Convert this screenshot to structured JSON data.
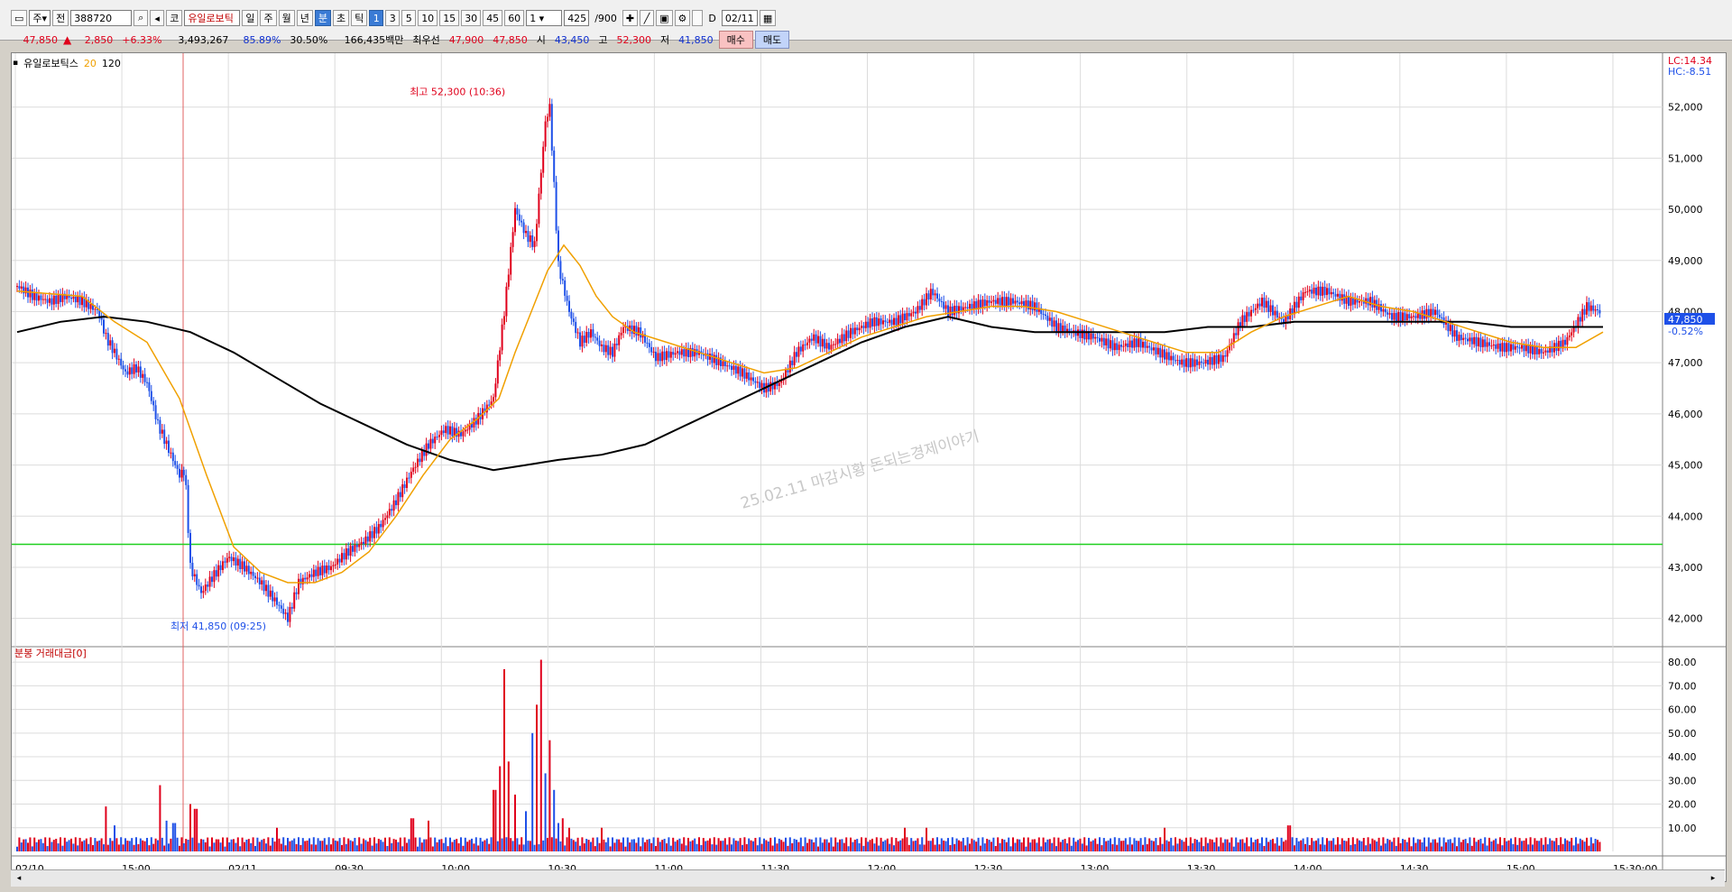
{
  "toolbar": {
    "market": "주",
    "scope": "전",
    "code": "388720",
    "name": "유일로보틱",
    "periods": [
      "일",
      "주",
      "월",
      "년",
      "분",
      "초",
      "틱"
    ],
    "period_selected": "분",
    "intervals": [
      "1",
      "3",
      "5",
      "10",
      "15",
      "30",
      "45",
      "60"
    ],
    "interval_selected": "1",
    "count_value": "1",
    "range_value": "425",
    "range_total": "/900",
    "date_checkbox_label": "D",
    "date_value": "02/11"
  },
  "quote": {
    "price": "47,850",
    "arrow": "▲",
    "change": "2,850",
    "change_pct": "+6.33%",
    "volume": "3,493,267",
    "ratio1": "85.89%",
    "ratio2": "30.50%",
    "amount": "166,435백만",
    "priority_label": "최우선",
    "ask": "47,900",
    "bid": "47,850",
    "open_label": "시",
    "open": "43,450",
    "high_label": "고",
    "high": "52,300",
    "low_label": "저",
    "low": "41,850",
    "buy_label": "매수",
    "sell_label": "매도"
  },
  "legend": {
    "name": "유일로보틱스",
    "ma20": "20",
    "ma120": "120"
  },
  "volume_label": "분봉 거래대금[0]",
  "colors": {
    "up": "#e0001b",
    "down": "#1e50e8",
    "ma20": "#f0a000",
    "ma120": "#000000",
    "support": "#20d020",
    "grid": "#dcdcdc"
  },
  "chart_data": [
    {
      "type": "candlestick",
      "ylim": [
        41500,
        52700
      ],
      "y_ticks": [
        "52,000",
        "51,000",
        "50,000",
        "49,000",
        "48,000",
        "47,000",
        "46,000",
        "45,000",
        "44,000",
        "43,000",
        "42,000"
      ],
      "x_ticks": [
        "02/10",
        "15:00",
        "02/11",
        "09:30",
        "10:00",
        "10:30",
        "11:00",
        "11:30",
        "12:00",
        "12:30",
        "13:00",
        "13:30",
        "14:00",
        "14:30",
        "15:00",
        "15:30:00"
      ],
      "current_price_label": "47,850",
      "current_change_label": "-0.52%",
      "lc_label": "LC:14.34",
      "hc_label": "HC:-8.51",
      "support_level": 43450,
      "high_annotation": "최고 52,300 (10:36)",
      "low_annotation": "최저 41,850 (09:25)",
      "watermark": "25.02.11 마감시황 돈되는경제이야기",
      "close_path": [
        [
          0,
          48500
        ],
        [
          15,
          48300
        ],
        [
          30,
          48200
        ],
        [
          45,
          48300
        ],
        [
          60,
          48200
        ],
        [
          75,
          48000
        ],
        [
          82,
          47500
        ],
        [
          90,
          47200
        ],
        [
          100,
          46800
        ],
        [
          110,
          46900
        ],
        [
          120,
          46600
        ],
        [
          130,
          45800
        ],
        [
          140,
          45300
        ],
        [
          150,
          44800
        ],
        [
          155,
          44900
        ],
        [
          160,
          43000
        ],
        [
          170,
          42500
        ],
        [
          180,
          42800
        ],
        [
          195,
          43200
        ],
        [
          210,
          43000
        ],
        [
          225,
          42700
        ],
        [
          240,
          42300
        ],
        [
          250,
          42000
        ],
        [
          260,
          42700
        ],
        [
          275,
          42900
        ],
        [
          290,
          43000
        ],
        [
          305,
          43300
        ],
        [
          320,
          43500
        ],
        [
          335,
          43800
        ],
        [
          350,
          44300
        ],
        [
          365,
          44900
        ],
        [
          380,
          45400
        ],
        [
          395,
          45700
        ],
        [
          410,
          45600
        ],
        [
          425,
          45900
        ],
        [
          440,
          46300
        ],
        [
          450,
          48000
        ],
        [
          460,
          50000
        ],
        [
          470,
          49500
        ],
        [
          478,
          49300
        ],
        [
          488,
          51700
        ],
        [
          492,
          52000
        ],
        [
          500,
          48900
        ],
        [
          510,
          48000
        ],
        [
          520,
          47400
        ],
        [
          530,
          47600
        ],
        [
          540,
          47300
        ],
        [
          550,
          47200
        ],
        [
          560,
          47700
        ],
        [
          575,
          47600
        ],
        [
          590,
          47100
        ],
        [
          610,
          47200
        ],
        [
          630,
          47200
        ],
        [
          650,
          47000
        ],
        [
          670,
          46800
        ],
        [
          690,
          46500
        ],
        [
          705,
          46600
        ],
        [
          720,
          47200
        ],
        [
          735,
          47500
        ],
        [
          750,
          47300
        ],
        [
          770,
          47600
        ],
        [
          790,
          47800
        ],
        [
          810,
          47800
        ],
        [
          830,
          48000
        ],
        [
          845,
          48400
        ],
        [
          860,
          48000
        ],
        [
          880,
          48100
        ],
        [
          900,
          48200
        ],
        [
          920,
          48200
        ],
        [
          940,
          48100
        ],
        [
          960,
          47700
        ],
        [
          975,
          47600
        ],
        [
          995,
          47500
        ],
        [
          1015,
          47300
        ],
        [
          1035,
          47400
        ],
        [
          1055,
          47200
        ],
        [
          1075,
          47000
        ],
        [
          1095,
          47000
        ],
        [
          1115,
          47100
        ],
        [
          1130,
          47800
        ],
        [
          1150,
          48200
        ],
        [
          1170,
          47800
        ],
        [
          1190,
          48400
        ],
        [
          1210,
          48400
        ],
        [
          1230,
          48200
        ],
        [
          1250,
          48200
        ],
        [
          1270,
          47900
        ],
        [
          1290,
          47900
        ],
        [
          1310,
          48000
        ],
        [
          1330,
          47500
        ],
        [
          1350,
          47400
        ],
        [
          1370,
          47300
        ],
        [
          1390,
          47300
        ],
        [
          1410,
          47200
        ],
        [
          1430,
          47400
        ],
        [
          1450,
          48100
        ],
        [
          1462,
          48000
        ]
      ],
      "ma20_path": [
        [
          0,
          48400
        ],
        [
          60,
          48300
        ],
        [
          90,
          47800
        ],
        [
          120,
          47400
        ],
        [
          150,
          46300
        ],
        [
          175,
          44800
        ],
        [
          200,
          43400
        ],
        [
          225,
          42900
        ],
        [
          250,
          42700
        ],
        [
          275,
          42700
        ],
        [
          300,
          42900
        ],
        [
          325,
          43300
        ],
        [
          350,
          44000
        ],
        [
          375,
          44800
        ],
        [
          400,
          45500
        ],
        [
          425,
          45900
        ],
        [
          445,
          46300
        ],
        [
          460,
          47200
        ],
        [
          475,
          48000
        ],
        [
          490,
          48800
        ],
        [
          505,
          49300
        ],
        [
          520,
          48900
        ],
        [
          535,
          48300
        ],
        [
          550,
          47900
        ],
        [
          570,
          47600
        ],
        [
          600,
          47400
        ],
        [
          630,
          47200
        ],
        [
          660,
          47000
        ],
        [
          690,
          46800
        ],
        [
          720,
          46900
        ],
        [
          750,
          47200
        ],
        [
          780,
          47500
        ],
        [
          810,
          47700
        ],
        [
          840,
          47900
        ],
        [
          870,
          48000
        ],
        [
          900,
          48100
        ],
        [
          930,
          48100
        ],
        [
          960,
          48000
        ],
        [
          990,
          47800
        ],
        [
          1020,
          47600
        ],
        [
          1050,
          47400
        ],
        [
          1080,
          47200
        ],
        [
          1110,
          47200
        ],
        [
          1140,
          47600
        ],
        [
          1170,
          47900
        ],
        [
          1200,
          48100
        ],
        [
          1230,
          48300
        ],
        [
          1260,
          48100
        ],
        [
          1290,
          48000
        ],
        [
          1320,
          47800
        ],
        [
          1350,
          47600
        ],
        [
          1380,
          47400
        ],
        [
          1410,
          47300
        ],
        [
          1440,
          47300
        ],
        [
          1465,
          47600
        ]
      ],
      "ma120_path": [
        [
          0,
          47600
        ],
        [
          40,
          47800
        ],
        [
          80,
          47900
        ],
        [
          120,
          47800
        ],
        [
          160,
          47600
        ],
        [
          200,
          47200
        ],
        [
          240,
          46700
        ],
        [
          280,
          46200
        ],
        [
          320,
          45800
        ],
        [
          360,
          45400
        ],
        [
          400,
          45100
        ],
        [
          440,
          44900
        ],
        [
          470,
          45000
        ],
        [
          500,
          45100
        ],
        [
          540,
          45200
        ],
        [
          580,
          45400
        ],
        [
          620,
          45800
        ],
        [
          660,
          46200
        ],
        [
          700,
          46600
        ],
        [
          740,
          47000
        ],
        [
          780,
          47400
        ],
        [
          820,
          47700
        ],
        [
          860,
          47900
        ],
        [
          900,
          47700
        ],
        [
          940,
          47600
        ],
        [
          980,
          47600
        ],
        [
          1020,
          47600
        ],
        [
          1060,
          47600
        ],
        [
          1100,
          47700
        ],
        [
          1140,
          47700
        ],
        [
          1180,
          47800
        ],
        [
          1220,
          47800
        ],
        [
          1260,
          47800
        ],
        [
          1300,
          47800
        ],
        [
          1340,
          47800
        ],
        [
          1380,
          47700
        ],
        [
          1420,
          47700
        ],
        [
          1465,
          47700
        ]
      ]
    },
    {
      "type": "bar",
      "ylim": [
        0,
        85
      ],
      "y_ticks": [
        "80.00",
        "70.00",
        "60.00",
        "50.00",
        "40.00",
        "30.00",
        "20.00",
        "10.00"
      ],
      "spikes": [
        {
          "x": 82,
          "v": 19,
          "up": true
        },
        {
          "x": 90,
          "v": 11,
          "up": false
        },
        {
          "x": 132,
          "v": 28,
          "up": true
        },
        {
          "x": 138,
          "v": 13,
          "up": false
        },
        {
          "x": 145,
          "v": 12,
          "up": false
        },
        {
          "x": 160,
          "v": 20,
          "up": true
        },
        {
          "x": 165,
          "v": 18,
          "up": true
        },
        {
          "x": 240,
          "v": 10,
          "up": true
        },
        {
          "x": 365,
          "v": 14,
          "up": true
        },
        {
          "x": 380,
          "v": 13,
          "up": true
        },
        {
          "x": 441,
          "v": 26,
          "up": true
        },
        {
          "x": 446,
          "v": 36,
          "up": true
        },
        {
          "x": 450,
          "v": 77,
          "up": true
        },
        {
          "x": 454,
          "v": 38,
          "up": true
        },
        {
          "x": 460,
          "v": 24,
          "up": true
        },
        {
          "x": 470,
          "v": 17,
          "up": false
        },
        {
          "x": 476,
          "v": 50,
          "up": false
        },
        {
          "x": 480,
          "v": 62,
          "up": true
        },
        {
          "x": 484,
          "v": 81,
          "up": true
        },
        {
          "x": 488,
          "v": 33,
          "up": false
        },
        {
          "x": 492,
          "v": 47,
          "up": true
        },
        {
          "x": 496,
          "v": 26,
          "up": false
        },
        {
          "x": 500,
          "v": 12,
          "up": false
        },
        {
          "x": 504,
          "v": 14,
          "up": true
        },
        {
          "x": 510,
          "v": 10,
          "up": true
        },
        {
          "x": 540,
          "v": 10,
          "up": true
        },
        {
          "x": 820,
          "v": 10,
          "up": true
        },
        {
          "x": 840,
          "v": 10,
          "up": true
        },
        {
          "x": 1060,
          "v": 10,
          "up": true
        },
        {
          "x": 1175,
          "v": 11,
          "up": true
        },
        {
          "x": 1465,
          "v": 11,
          "up": true
        }
      ]
    }
  ]
}
